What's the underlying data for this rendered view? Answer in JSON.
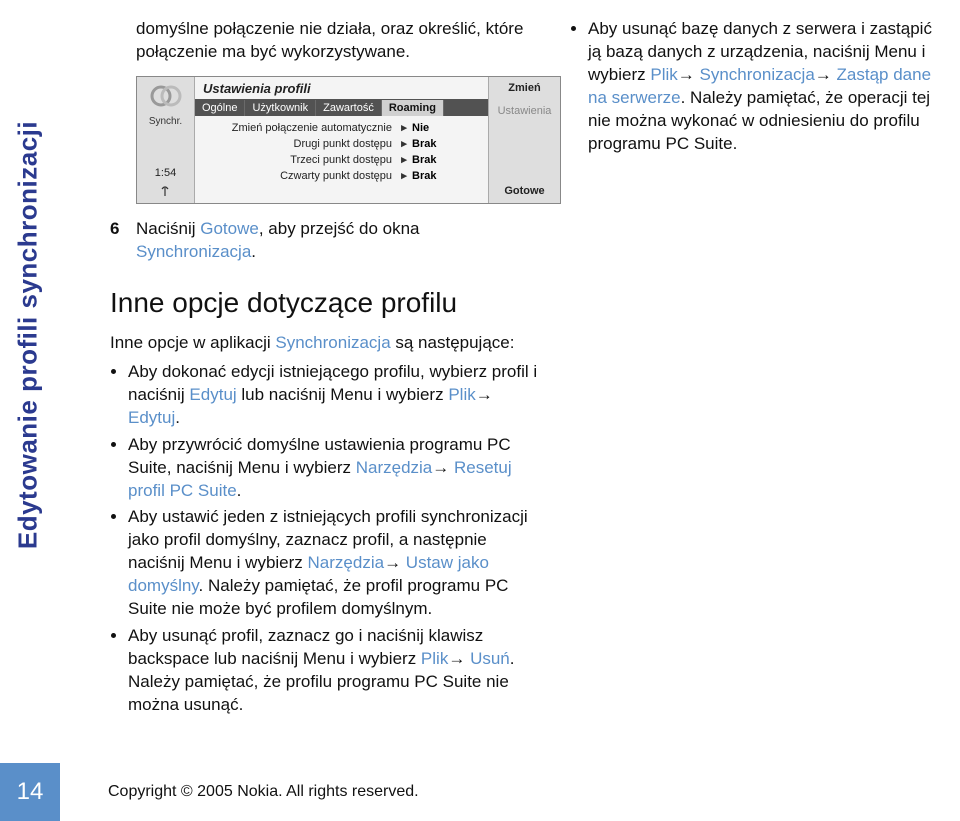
{
  "side_title": "Edytowanie profili synchronizacji",
  "intro_para": "domyślne połączenie nie działa, oraz określić, które połączenie ma być wykorzystywane.",
  "screenshot": {
    "app_label": "Synchr.",
    "clock": "1:54",
    "title": "Ustawienia profili",
    "tabs": [
      "Ogólne",
      "Użytkownik",
      "Zawartość",
      "Roaming"
    ],
    "active_tab": 3,
    "rows": [
      {
        "label": "Zmień połączenie automatycznie",
        "value": "Nie"
      },
      {
        "label": "Drugi punkt dostępu",
        "value": "Brak"
      },
      {
        "label": "Trzeci punkt dostępu",
        "value": "Brak"
      },
      {
        "label": "Czwarty punkt dostępu",
        "value": "Brak"
      }
    ],
    "right_buttons": {
      "top": "Zmień",
      "mid": "Ustawienia",
      "bottom": "Gotowe"
    }
  },
  "step6": {
    "num": "6",
    "pre": "Naciśnij ",
    "key": "Gotowe",
    "mid": ", aby przejść do okna ",
    "key2": "Synchronizacja",
    "post": "."
  },
  "section_heading": "Inne opcje dotyczące profilu",
  "sub_intro_pre": "Inne opcje w aplikacji ",
  "sub_intro_key": "Synchronizacja",
  "sub_intro_post": " są następujące:",
  "bullets_left": [
    {
      "parts": [
        {
          "t": "Aby dokonać edycji istniejącego profilu, wybierz profil i naciśnij "
        },
        {
          "t": "Edytuj",
          "k": true
        },
        {
          "t": " lub naciśnij Menu i wybierz "
        },
        {
          "t": "Plik",
          "k": true
        },
        {
          "t": "→ ",
          "arrow": true
        },
        {
          "t": "Edytuj",
          "k": true
        },
        {
          "t": "."
        }
      ]
    },
    {
      "parts": [
        {
          "t": "Aby przywrócić domyślne ustawienia programu PC Suite, naciśnij Menu i wybierz "
        },
        {
          "t": "Narzędzia",
          "k": true
        },
        {
          "t": "→ ",
          "arrow": true
        },
        {
          "t": "Resetuj profil PC Suite",
          "k": true
        },
        {
          "t": "."
        }
      ]
    },
    {
      "parts": [
        {
          "t": "Aby ustawić jeden z istniejących profili synchronizacji jako profil domyślny, zaznacz profil, a następnie naciśnij Menu i wybierz "
        },
        {
          "t": "Narzędzia",
          "k": true
        },
        {
          "t": "→ ",
          "arrow": true
        },
        {
          "t": "Ustaw jako domyślny",
          "k": true
        },
        {
          "t": ". Należy pamiętać, że profil programu PC Suite nie może być profilem domyślnym."
        }
      ]
    },
    {
      "parts": [
        {
          "t": "Aby usunąć profil, zaznacz go i naciśnij klawisz backspace lub naciśnij Menu i wybierz "
        },
        {
          "t": "Plik",
          "k": true
        },
        {
          "t": "→ ",
          "arrow": true
        },
        {
          "t": "Usuń",
          "k": true
        },
        {
          "t": ". Należy pamiętać, że profilu programu PC Suite nie można usunąć."
        }
      ]
    }
  ],
  "bullets_right": [
    {
      "parts": [
        {
          "t": "Aby usunąć bazę danych z serwera i zastąpić ją bazą danych z urządzenia, naciśnij Menu i wybierz "
        },
        {
          "t": "Plik",
          "k": true
        },
        {
          "t": "→ ",
          "arrow": true
        },
        {
          "t": "Synchronizacja",
          "k": true
        },
        {
          "t": "→ ",
          "arrow": true
        },
        {
          "t": "Zastąp dane na serwerze",
          "k": true
        },
        {
          "t": ". Należy pamiętać, że operacji tej nie można wykonać w odniesieniu do profilu programu PC Suite."
        }
      ]
    }
  ],
  "page_number": "14",
  "copyright": "Copyright © 2005 Nokia. All rights reserved."
}
